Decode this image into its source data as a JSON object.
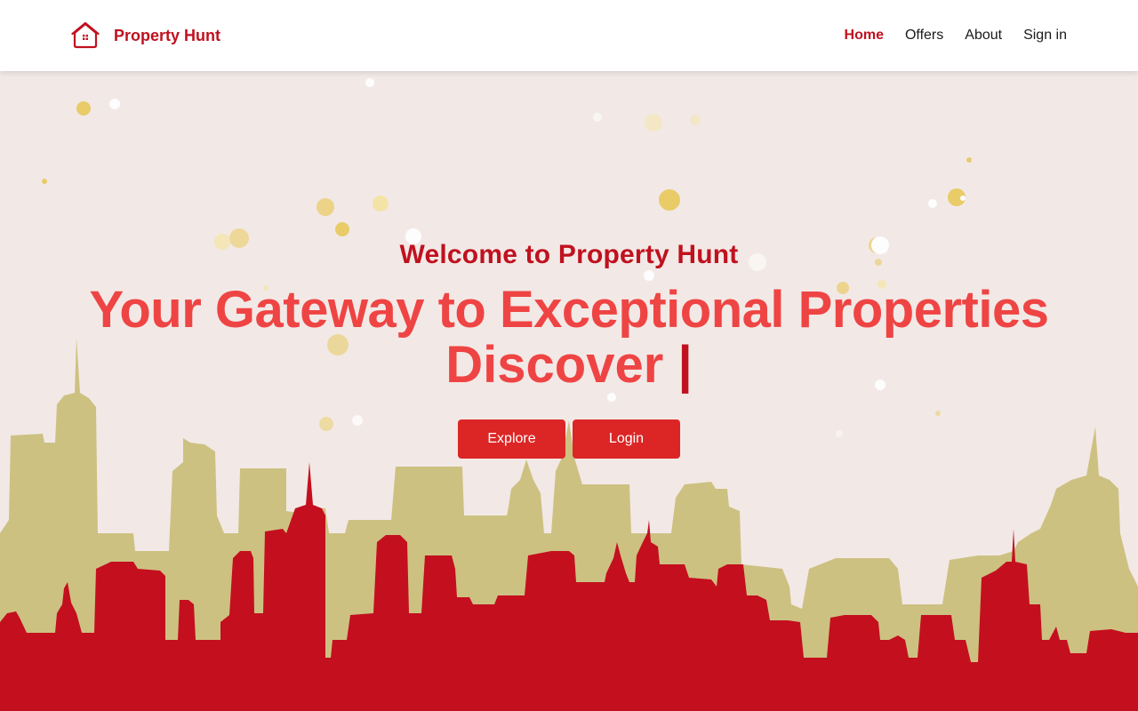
{
  "nav": {
    "brand_name": "Property Hunt",
    "links": [
      {
        "label": "Home",
        "active": true
      },
      {
        "label": "Offers",
        "active": false
      },
      {
        "label": "About",
        "active": false
      },
      {
        "label": "Sign in",
        "active": false
      }
    ]
  },
  "hero": {
    "welcome": "Welcome to Property Hunt",
    "headline": "Your Gateway to Exceptional Properties",
    "typed_word": "Discover",
    "cursor": "|",
    "buttons": {
      "explore": "Explore",
      "login": "Login"
    }
  },
  "colors": {
    "brand": "#c0111f",
    "headline": "#ef4444",
    "button": "#dc2626",
    "background": "#f2e9e6",
    "skyline_back": "#cdc182",
    "skyline_front": "#c40f1e"
  }
}
